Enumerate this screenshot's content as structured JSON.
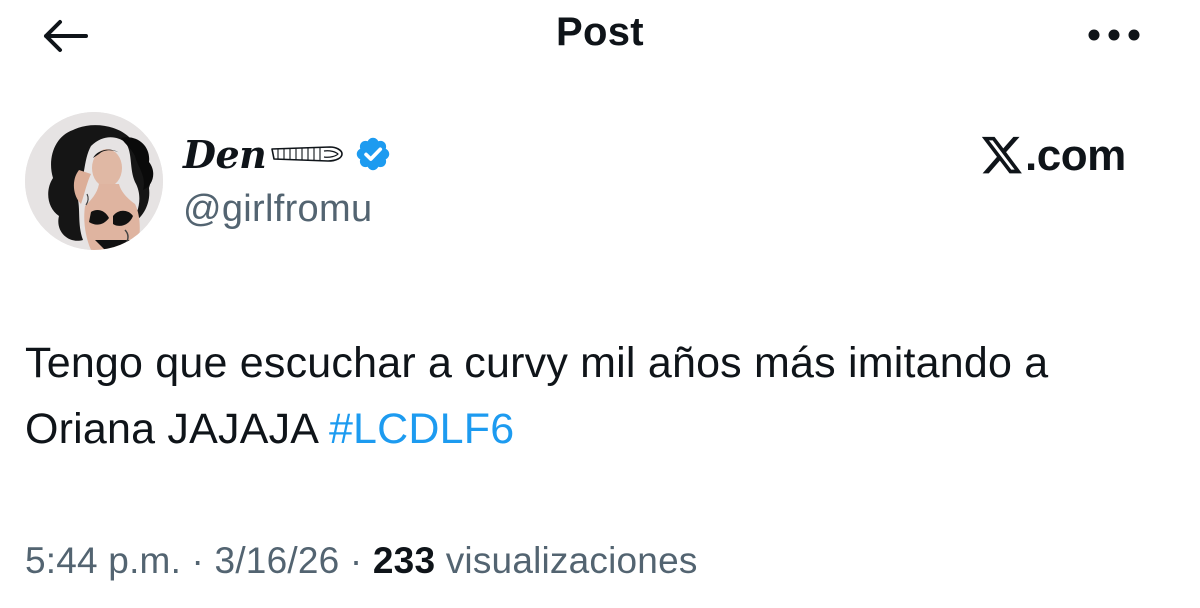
{
  "header": {
    "back_icon": "arrow-left-icon",
    "title": "Post",
    "more_icon": "more-horizontal-icon"
  },
  "author": {
    "display_name": "Den",
    "display_name_emoji": "wing-icon",
    "verified": true,
    "verified_color": "#1d9bf0",
    "handle": "@girlfromu",
    "avatar": "avatar"
  },
  "watermark": {
    "logo_icon": "x-logo-icon",
    "text": ".com"
  },
  "tweet": {
    "text": "Tengo que escuchar a curvy mil años más imitando a Oriana JAJAJA",
    "hashtag": "#LCDLF6",
    "hashtag_color": "#1d9bf0"
  },
  "meta": {
    "time": "5:44 p.m.",
    "separator": " · ",
    "date": "3/16/26",
    "views_count": "233",
    "views_label": "visualizaciones"
  }
}
